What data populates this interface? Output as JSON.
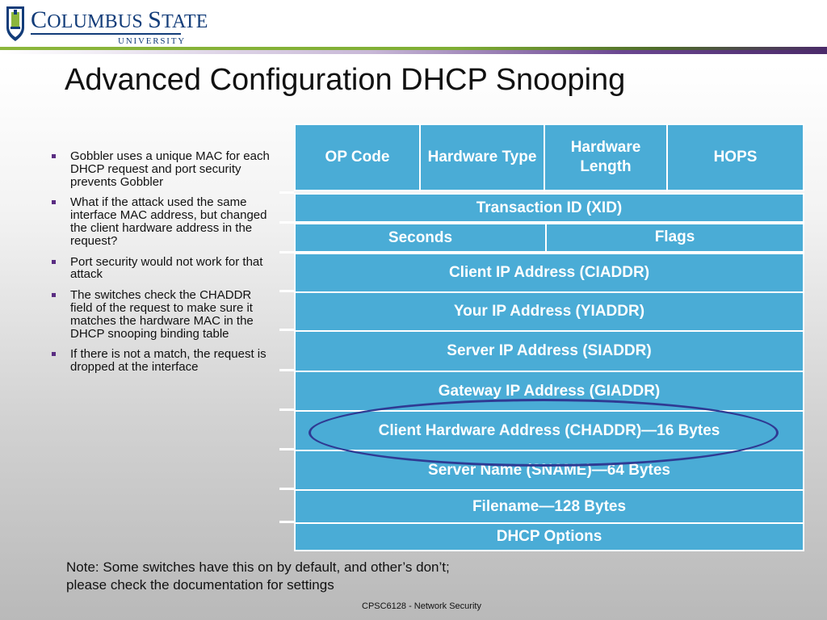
{
  "logo": {
    "main": "Columbus State",
    "main_big_c": "C",
    "main_rest": "OLUMBUS ",
    "main_big_s": "S",
    "main_rest2": "TATE",
    "sub": "UNIVERSITY"
  },
  "title": "Advanced Configuration DHCP Snooping",
  "bullets": [
    "Gobbler uses a unique MAC for each DHCP request and port security prevents Gobbler",
    "What if the attack used the same interface MAC address, but changed the client hardware address in the request?",
    "Port security would not work for that attack",
    "The switches check the CHADDR field of the request to make sure it matches the hardware MAC in the DHCP snooping binding table",
    "If there is not a match, the request is dropped at the interface"
  ],
  "packet": {
    "op_code": "OP Code",
    "hardware_type": "Hardware Type",
    "hardware_length": "Hardware Length",
    "hops": "HOPS",
    "xid": "Transaction ID (XID)",
    "seconds": "Seconds",
    "flags": "Flags",
    "ciaddr": "Client IP Address (CIADDR)",
    "yiaddr": "Your IP Address (YIADDR)",
    "siaddr": "Server IP Address (SIADDR)",
    "giaddr": "Gateway IP Address (GIADDR)",
    "chaddr": "Client Hardware Address (CHADDR)—16 Bytes",
    "sname": "Server Name (SNAME)—64 Bytes",
    "filename": "Filename—128 Bytes",
    "options": "DHCP Options"
  },
  "note": {
    "line1": "Note: Some switches have this on by default, and other’s don’t;",
    "line2": "please check the documentation for settings"
  },
  "footer": "CPSC6128 - Network Security",
  "colors": {
    "cell": "#4aacd6",
    "highlight_oval": "#2f3a93",
    "brand_blue": "#123c79",
    "brand_green": "#8cb63c",
    "brand_purple": "#4b2a6a"
  }
}
